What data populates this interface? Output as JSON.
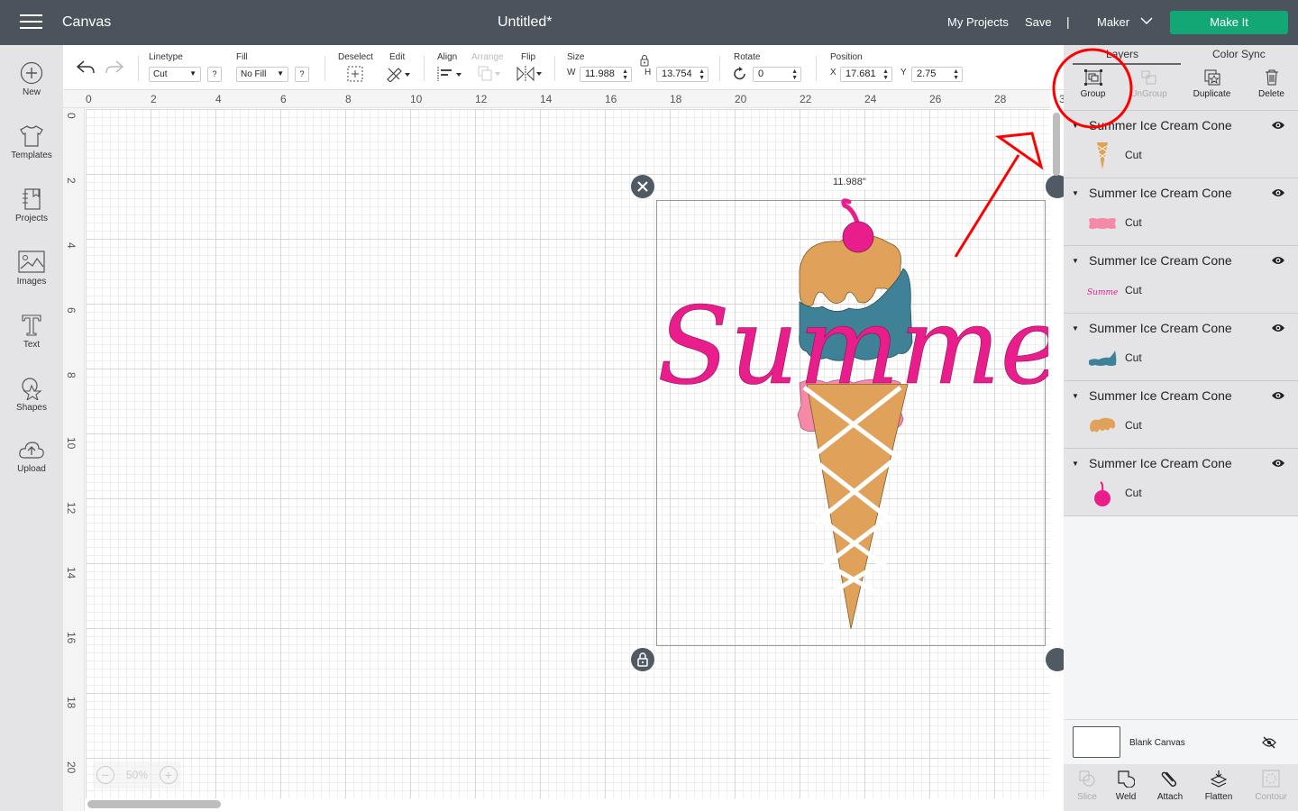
{
  "topbar": {
    "app_title": "Canvas",
    "document_title": "Untitled*",
    "my_projects": "My Projects",
    "save": "Save",
    "separator": "|",
    "machine": "Maker",
    "make_it": "Make It",
    "make_it_color": "#12a774"
  },
  "leftbar": {
    "items": [
      {
        "label": "New",
        "icon": "plus-circle-icon"
      },
      {
        "label": "Templates",
        "icon": "tshirt-icon"
      },
      {
        "label": "Projects",
        "icon": "notebook-icon"
      },
      {
        "label": "Images",
        "icon": "image-icon"
      },
      {
        "label": "Text",
        "icon": "text-icon"
      },
      {
        "label": "Shapes",
        "icon": "shapes-icon"
      },
      {
        "label": "Upload",
        "icon": "cloud-upload-icon"
      }
    ]
  },
  "toolbar": {
    "linetype_label": "Linetype",
    "linetype_value": "Cut",
    "fill_label": "Fill",
    "fill_value": "No Fill",
    "help": "?",
    "deselect_label": "Deselect",
    "edit_label": "Edit",
    "align_label": "Align",
    "arrange_label": "Arrange",
    "flip_label": "Flip",
    "size_label": "Size",
    "w_label": "W",
    "width_value": "11.988",
    "h_label": "H",
    "height_value": "13.754",
    "rotate_label": "Rotate",
    "rotate_value": "0",
    "position_label": "Position",
    "x_label": "X",
    "x_value": "17.681",
    "y_label": "Y",
    "y_value": "2.75"
  },
  "canvas": {
    "ruler_top": [
      "0",
      "2",
      "4",
      "6",
      "8",
      "10",
      "12",
      "14",
      "16",
      "18",
      "20",
      "22",
      "24",
      "26",
      "28",
      "3"
    ],
    "ruler_left": [
      "0",
      "2",
      "4",
      "6",
      "8",
      "10",
      "12",
      "14",
      "16",
      "18",
      "20"
    ],
    "selection_width_label": "11.988\"",
    "zoom_level": "50%",
    "zoom_out": "−",
    "zoom_in": "+",
    "design_text": "Summer",
    "colors": {
      "pink": "#e91e8c",
      "light_pink": "#f48aa8",
      "tan": "#e0a25a",
      "teal": "#3f8197",
      "annotation_red": "#ff0000"
    }
  },
  "panel": {
    "tabs": [
      "Layers",
      "Color Sync"
    ],
    "actions": [
      {
        "label": "Group",
        "enabled": true
      },
      {
        "label": "UnGroup",
        "enabled": false
      },
      {
        "label": "Duplicate",
        "enabled": true
      },
      {
        "label": "Delete",
        "enabled": true
      }
    ],
    "layers": [
      {
        "name": "Summer Ice Cream Cone",
        "operation": "Cut",
        "thumb": "cone"
      },
      {
        "name": "Summer Ice Cream Cone",
        "operation": "Cut",
        "thumb": "pink-scoop"
      },
      {
        "name": "Summer Ice Cream Cone",
        "operation": "Cut",
        "thumb": "summer-text"
      },
      {
        "name": "Summer Ice Cream Cone",
        "operation": "Cut",
        "thumb": "teal-scoop"
      },
      {
        "name": "Summer Ice Cream Cone",
        "operation": "Cut",
        "thumb": "tan-scoop"
      },
      {
        "name": "Summer Ice Cream Cone",
        "operation": "Cut",
        "thumb": "cherry"
      }
    ],
    "blank_canvas": "Blank Canvas",
    "bottom_actions": [
      {
        "label": "Slice",
        "enabled": false
      },
      {
        "label": "Weld",
        "enabled": true
      },
      {
        "label": "Attach",
        "enabled": true
      },
      {
        "label": "Flatten",
        "enabled": true
      },
      {
        "label": "Contour",
        "enabled": false
      }
    ]
  }
}
